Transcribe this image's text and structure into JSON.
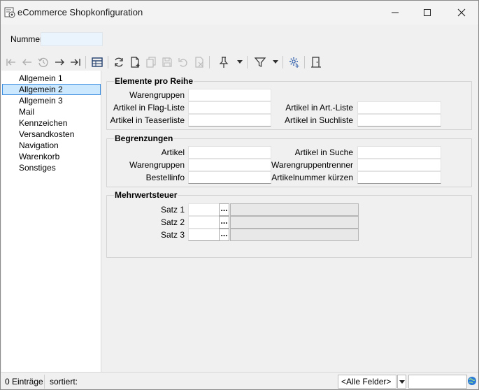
{
  "window": {
    "title": "eCommerce Shopkonfiguration"
  },
  "header": {
    "nummer_label": "Nummer",
    "nummer_value": ""
  },
  "toolbar": {
    "icons": [
      "first-icon",
      "back-icon",
      "history-icon",
      "forward-icon",
      "last-icon",
      "table-icon",
      "refresh-icon",
      "new-document-icon",
      "copy-icon",
      "save-icon",
      "undo-icon",
      "delete-icon",
      "pin-icon",
      "filter-icon",
      "settings-icon",
      "exit-icon"
    ]
  },
  "sidebar": {
    "items": [
      {
        "label": "Allgemein 1"
      },
      {
        "label": "Allgemein 2",
        "selected": true
      },
      {
        "label": "Allgemein 3"
      },
      {
        "label": "Mail"
      },
      {
        "label": "Kennzeichen"
      },
      {
        "label": "Versandkosten"
      },
      {
        "label": "Navigation"
      },
      {
        "label": "Warenkorb"
      },
      {
        "label": "Sonstiges"
      }
    ]
  },
  "groups": {
    "elemente": {
      "title": "Elemente pro Reihe",
      "warengruppen": "Warengruppen",
      "artikel_flag": "Artikel in Flag-Liste",
      "artikel_teaser": "Artikel in Teaserliste",
      "artikel_art": "Artikel in Art.-Liste",
      "artikel_such": "Artikel in Suchliste"
    },
    "begrenzungen": {
      "title": "Begrenzungen",
      "artikel": "Artikel",
      "warengruppen": "Warengruppen",
      "bestellinfo": "Bestellinfo",
      "artikel_suche": "Artikel in Suche",
      "warengruppentrenner": "Warengruppentrenner",
      "artikelnummer": "Artikelnummer kürzen"
    },
    "mwst": {
      "title": "Mehrwertsteuer",
      "satz1": "Satz 1",
      "satz2": "Satz 2",
      "satz3": "Satz 3",
      "dots": "..."
    }
  },
  "statusbar": {
    "count": "0 Einträge",
    "sorted": "sortiert:",
    "field_filter": "<Alle Felder>"
  },
  "colors": {
    "selection_bg": "#cce8ff",
    "selection_border": "#3d8ee0",
    "input_bg": "#eaf4fd"
  }
}
